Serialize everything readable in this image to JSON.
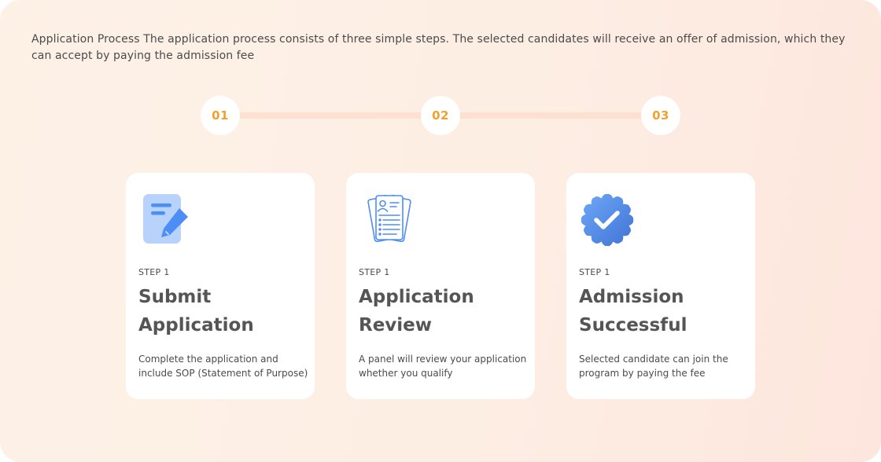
{
  "intro": {
    "text": "Application Process The application process consists of three simple steps. The selected candidates will receive an offer of admission, which they can accept by paying the admission fee"
  },
  "timeline": {
    "steps": [
      "01",
      "02",
      "03"
    ]
  },
  "cards": [
    {
      "icon": "document-edit-icon",
      "step_label": "STEP 1",
      "title": "Submit Application",
      "description": "Complete the application and include SOP (Statement of Purpose)"
    },
    {
      "icon": "resume-document-icon",
      "step_label": "STEP 1",
      "title": "Application Review",
      "description": "A panel will review your application whether you qualify"
    },
    {
      "icon": "verified-badge-icon",
      "step_label": "STEP 1",
      "title": "Admission Successful",
      "description": "Selected candidate can join the program by paying the fee"
    }
  ],
  "colors": {
    "accent": "#f5a02c",
    "icon_blue": "#4c8df6",
    "track": "#fde0cf"
  }
}
